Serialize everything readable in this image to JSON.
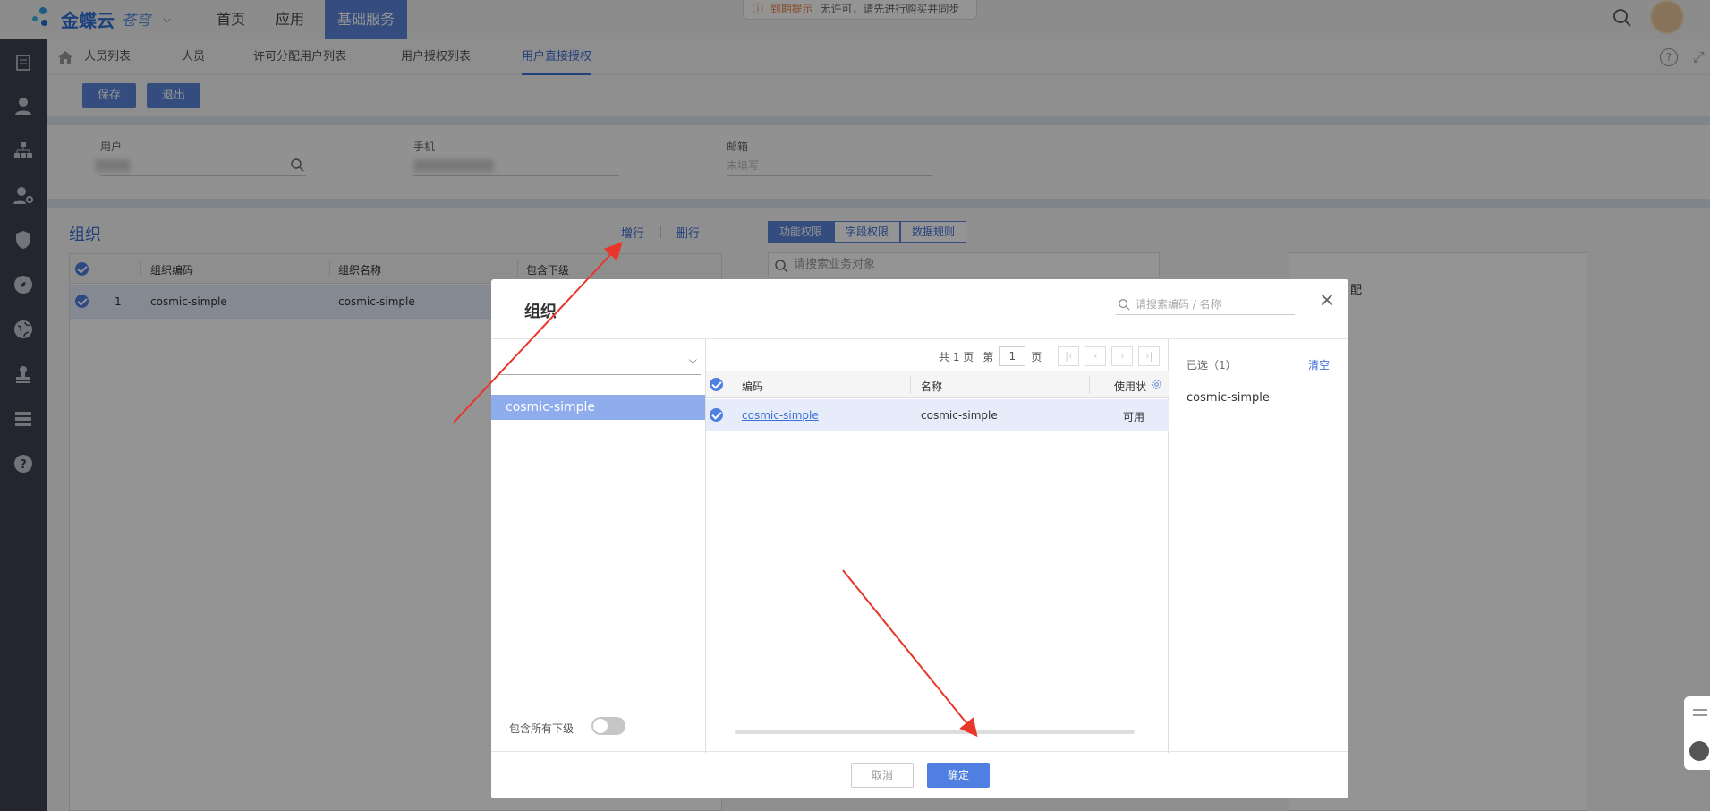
{
  "header": {
    "logo_text": "金蝶云",
    "logo_sub": "苍穹",
    "nav": [
      {
        "label": "首页"
      },
      {
        "label": "应用"
      },
      {
        "label": "基础服务"
      }
    ],
    "notice_title": "到期提示",
    "notice_text": "无许可，请先进行购买并同步"
  },
  "subtabs": [
    {
      "label": "人员列表"
    },
    {
      "label": "人员"
    },
    {
      "label": "许可分配用户列表"
    },
    {
      "label": "用户授权列表"
    },
    {
      "label": "用户直接授权"
    }
  ],
  "toolbar": {
    "save_label": "保存",
    "exit_label": "退出"
  },
  "form": {
    "user_label": "用户",
    "phone_label": "手机",
    "email_label": "邮箱",
    "email_placeholder": "未填写"
  },
  "org_section": {
    "title": "组织",
    "add_row": "增行",
    "delete_row": "删行",
    "columns": [
      "组织编码",
      "组织名称",
      "包含下级"
    ],
    "rows": [
      {
        "index": "1",
        "code": "cosmic-simple",
        "name": "cosmic-simple"
      }
    ]
  },
  "perm_tabs": [
    {
      "label": "功能权限"
    },
    {
      "label": "字段权限"
    },
    {
      "label": "数据规则"
    }
  ],
  "perm_search_placeholder": "请搜索业务对象",
  "perm_partial_text": "配",
  "modal": {
    "title": "组织",
    "search_placeholder": "请搜索编码 / 名称",
    "tree_item": "cosmic-simple",
    "include_sub_label": "包含所有下级",
    "pager": {
      "total": "共 1 页",
      "prefix": "第",
      "page": "1",
      "suffix": "页"
    },
    "columns": [
      "编码",
      "名称",
      "使用状"
    ],
    "rows": [
      {
        "code": "cosmic-simple",
        "name": "cosmic-simple",
        "status": "可用"
      }
    ],
    "selected_label": "已选（1）",
    "clear_label": "清空",
    "selected_items": [
      "cosmic-simple"
    ],
    "cancel_label": "取消",
    "ok_label": "确定"
  },
  "colors": {
    "accent": "#3c6fd6",
    "sidebar": "#3d4352",
    "arrow": "#e8362b"
  }
}
